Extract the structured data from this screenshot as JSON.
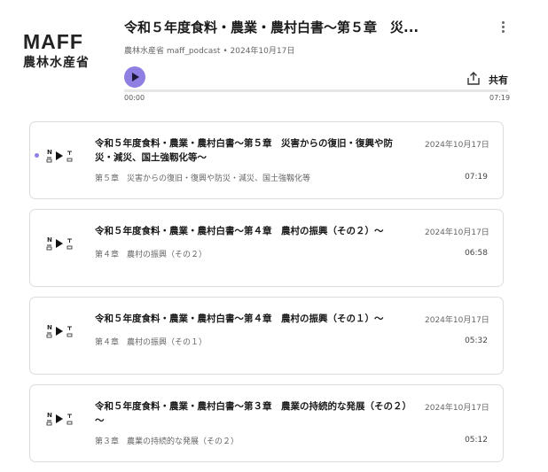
{
  "logo": {
    "main": "MAFF",
    "sub": "農林水産省"
  },
  "player": {
    "title": "令和５年度食料・農業・農村白書～第５章　災...",
    "channel": "農林水産省 maff_podcast",
    "separator": "•",
    "date": "2024年10月17日",
    "share_label": "共有",
    "time_current": "00:00",
    "time_total": "07:19",
    "progress": 0
  },
  "colors": {
    "accent": "#8f7fe3"
  },
  "episodes": [
    {
      "title": "令和５年度食料・農業・農村白書～第５章　災害からの復旧・復興や防災・減災、国土強靱化等～",
      "subtitle": "第５章　災害からの復旧・復興や防災・減災、国土強靱化等",
      "date": "2024年10月17日",
      "duration": "07:19",
      "current": true
    },
    {
      "title": "令和５年度食料・農業・農村白書～第４章　農村の振興（その２）～",
      "subtitle": "第４章　農村の振興（その２）",
      "date": "2024年10月17日",
      "duration": "06:58",
      "current": false
    },
    {
      "title": "令和５年度食料・農業・農村白書～第４章　農村の振興（その１）～",
      "subtitle": "第４章　農村の振興（その１）",
      "date": "2024年10月17日",
      "duration": "05:32",
      "current": false
    },
    {
      "title": "令和５年度食料・農業・農村白書～第３章　農業の持続的な発展（その２）～",
      "subtitle": "第３章　農業の持続的な発展（その２）",
      "date": "2024年10月17日",
      "duration": "05:12",
      "current": false
    }
  ]
}
